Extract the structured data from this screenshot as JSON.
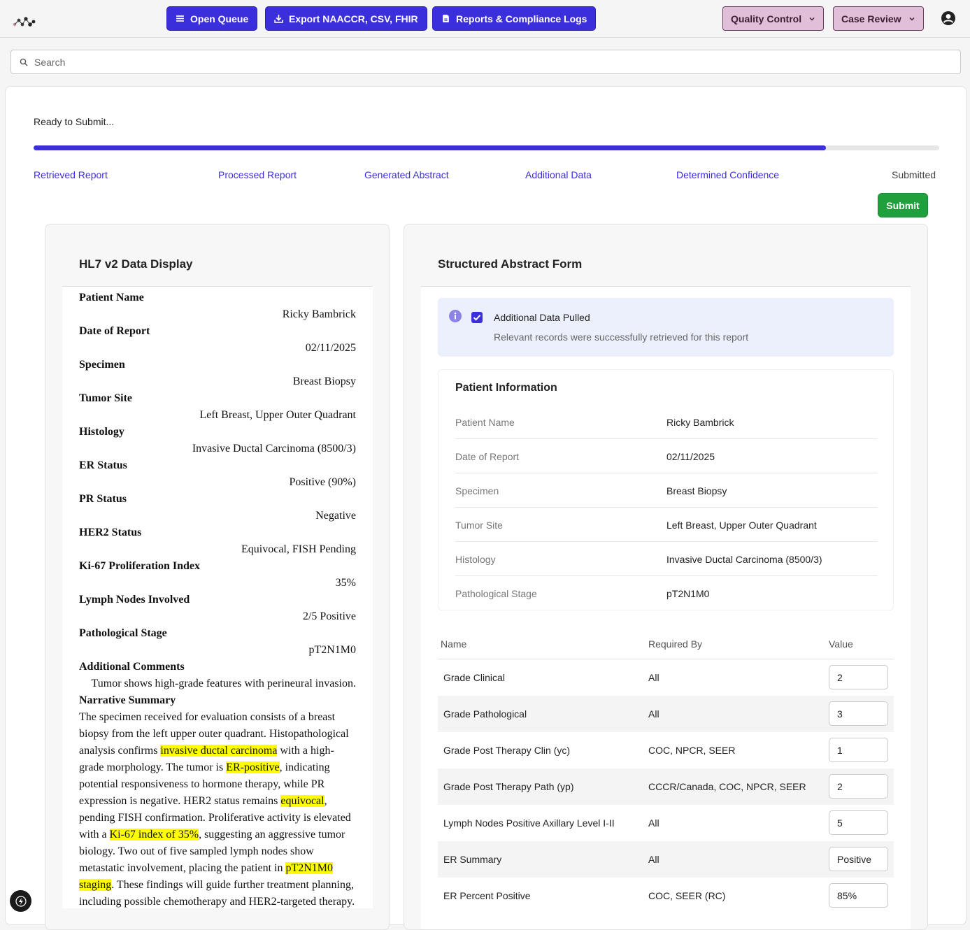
{
  "toolbar": {
    "open_queue": "Open Queue",
    "export": "Export NAACCR, CSV, FHIR",
    "reports": "Reports & Compliance Logs",
    "quality_control": "Quality Control",
    "case_review": "Case Review"
  },
  "search": {
    "placeholder": "Search"
  },
  "progress": {
    "status": "Ready to Submit...",
    "fraction": 0.875,
    "steps": [
      "Retrieved Report",
      "Processed Report",
      "Generated Abstract",
      "Additional Data",
      "Determined Confidence",
      "Submitted"
    ],
    "submit_label": "Submit"
  },
  "hl7": {
    "title": "HL7 v2 Data Display",
    "fields": [
      {
        "label": "Patient Name",
        "value": "Ricky Bambrick"
      },
      {
        "label": "Date of Report",
        "value": "02/11/2025"
      },
      {
        "label": "Specimen",
        "value": "Breast Biopsy"
      },
      {
        "label": "Tumor Site",
        "value": "Left Breast, Upper Outer Quadrant"
      },
      {
        "label": "Histology",
        "value": "Invasive Ductal Carcinoma (8500/3)"
      },
      {
        "label": "ER Status",
        "value": "Positive (90%)"
      },
      {
        "label": "PR Status",
        "value": "Negative"
      },
      {
        "label": "HER2 Status",
        "value": "Equivocal, FISH Pending"
      },
      {
        "label": "Ki-67 Proliferation Index",
        "value": "35%"
      },
      {
        "label": "Lymph Nodes Involved",
        "value": "2/5 Positive"
      },
      {
        "label": "Pathological Stage",
        "value": "pT2N1M0"
      },
      {
        "label": "Additional Comments",
        "value": "Tumor shows high-grade features with perineural invasion."
      }
    ],
    "narrative_label": "Narrative Summary",
    "narrative": [
      {
        "t": "The specimen received for evaluation consists of a breast biopsy from the left upper outer quadrant. Histopathological analysis confirms ",
        "h": false
      },
      {
        "t": "invasive ductal carcinoma",
        "h": true
      },
      {
        "t": " with a high-grade morphology. The tumor is ",
        "h": false
      },
      {
        "t": "ER-positive",
        "h": true
      },
      {
        "t": ", indicating potential responsiveness to hormone therapy, while PR expression is negative. HER2 status remains ",
        "h": false
      },
      {
        "t": "equivocal",
        "h": true
      },
      {
        "t": ", pending FISH confirmation. Proliferative activity is elevated with a ",
        "h": false
      },
      {
        "t": "Ki-67 index of 35%",
        "h": true
      },
      {
        "t": ", suggesting an aggressive tumor biology. Two out of five sampled lymph nodes show metastatic involvement, placing the patient in ",
        "h": false
      },
      {
        "t": "pT2N1M0 staging",
        "h": true
      },
      {
        "t": ". These findings will guide further treatment planning, including possible chemotherapy and HER2-targeted therapy.",
        "h": false
      }
    ]
  },
  "form": {
    "title": "Structured Abstract Form",
    "alert_title": "Additional Data Pulled",
    "alert_sub": "Relevant records were successfully retrieved for this report",
    "patient_title": "Patient Information",
    "patient": [
      {
        "k": "Patient Name",
        "v": "Ricky Bambrick"
      },
      {
        "k": "Date of Report",
        "v": "02/11/2025"
      },
      {
        "k": "Specimen",
        "v": "Breast Biopsy"
      },
      {
        "k": "Tumor Site",
        "v": "Left Breast, Upper Outer Quadrant"
      },
      {
        "k": "Histology",
        "v": "Invasive Ductal Carcinoma (8500/3)"
      },
      {
        "k": "Pathological Stage",
        "v": "pT2N1M0"
      }
    ],
    "columns": [
      "Name",
      "Required By",
      "Value"
    ],
    "rows": [
      {
        "name": "Grade Clinical",
        "req": "All",
        "value": "2"
      },
      {
        "name": "Grade Pathological",
        "req": "All",
        "value": "3"
      },
      {
        "name": "Grade Post Therapy Clin (yc)",
        "req": "COC, NPCR, SEER",
        "value": "1"
      },
      {
        "name": "Grade Post Therapy Path (yp)",
        "req": "CCCR/Canada, COC, NPCR, SEER",
        "value": "2"
      },
      {
        "name": "Lymph Nodes Positive Axillary Level I-II",
        "req": "All",
        "value": "5"
      },
      {
        "name": "ER Summary",
        "req": "All",
        "value": "Positive"
      },
      {
        "name": "ER Percent Positive",
        "req": "COC, SEER (RC)",
        "value": "85%"
      }
    ]
  },
  "colors": {
    "accent": "#3b2fdb",
    "submit": "#20a03c",
    "highlight": "#ffff00",
    "pink": "#e2bfd8"
  }
}
